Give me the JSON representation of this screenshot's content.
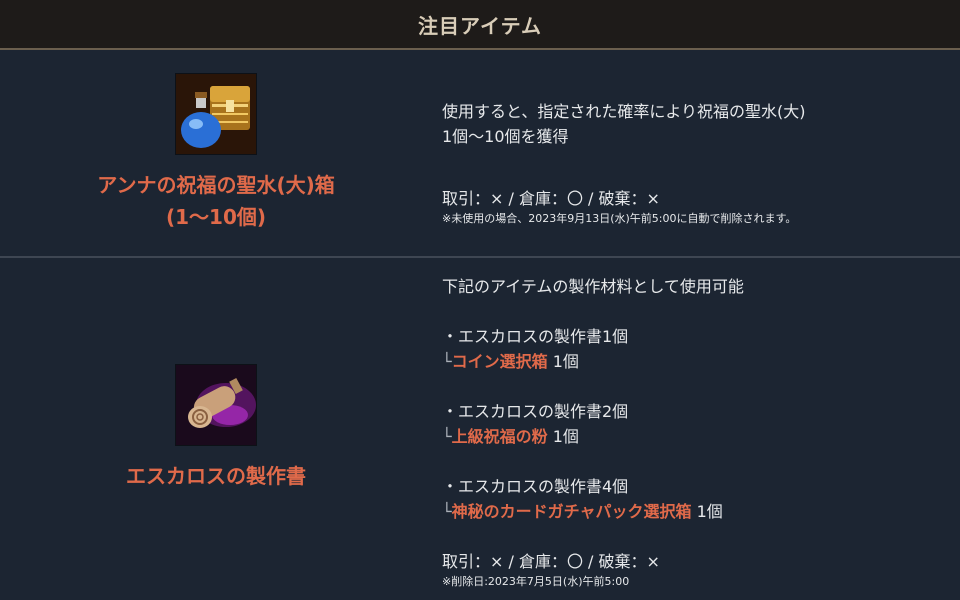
{
  "header": {
    "title": "注目アイテム"
  },
  "item1": {
    "name_line1": "アンナの祝福の聖水(大)箱",
    "name_line2": "(1〜10個)",
    "desc_line1": "使用すると、指定された確率により祝福の聖水(大)",
    "desc_line2": "1個〜10個を獲得",
    "trade": "取引：× / 倉庫：〇 / 破棄：×",
    "note": "※未使用の場合、2023年9月13日(水)午前5:00に自動で削除されます。"
  },
  "item2": {
    "name": "エスカロスの製作書",
    "intro": "下記のアイテムの製作材料として使用可能",
    "recipes": [
      {
        "book": "・エスカロスの製作書1個",
        "prefix": "└",
        "result": "コイン選択箱",
        "qty": " 1個"
      },
      {
        "book": "・エスカロスの製作書2個",
        "prefix": "└",
        "result": "上級祝福の粉",
        "qty": " 1個"
      },
      {
        "book": "・エスカロスの製作書4個",
        "prefix": "└",
        "result": "神秘のカードガチャパック選択箱",
        "qty": " 1個"
      }
    ],
    "trade": "取引：× / 倉庫：〇 / 破棄：×",
    "note": "※削除日:2023年7月5日(水)午前5:00"
  },
  "colors": {
    "accent": "#e06a4a",
    "background": "#1c2532",
    "header": "#1e1b19",
    "header_text": "#d9cdb8"
  },
  "icons": [
    "treasure-chest-potion-icon",
    "scroll-icon"
  ]
}
